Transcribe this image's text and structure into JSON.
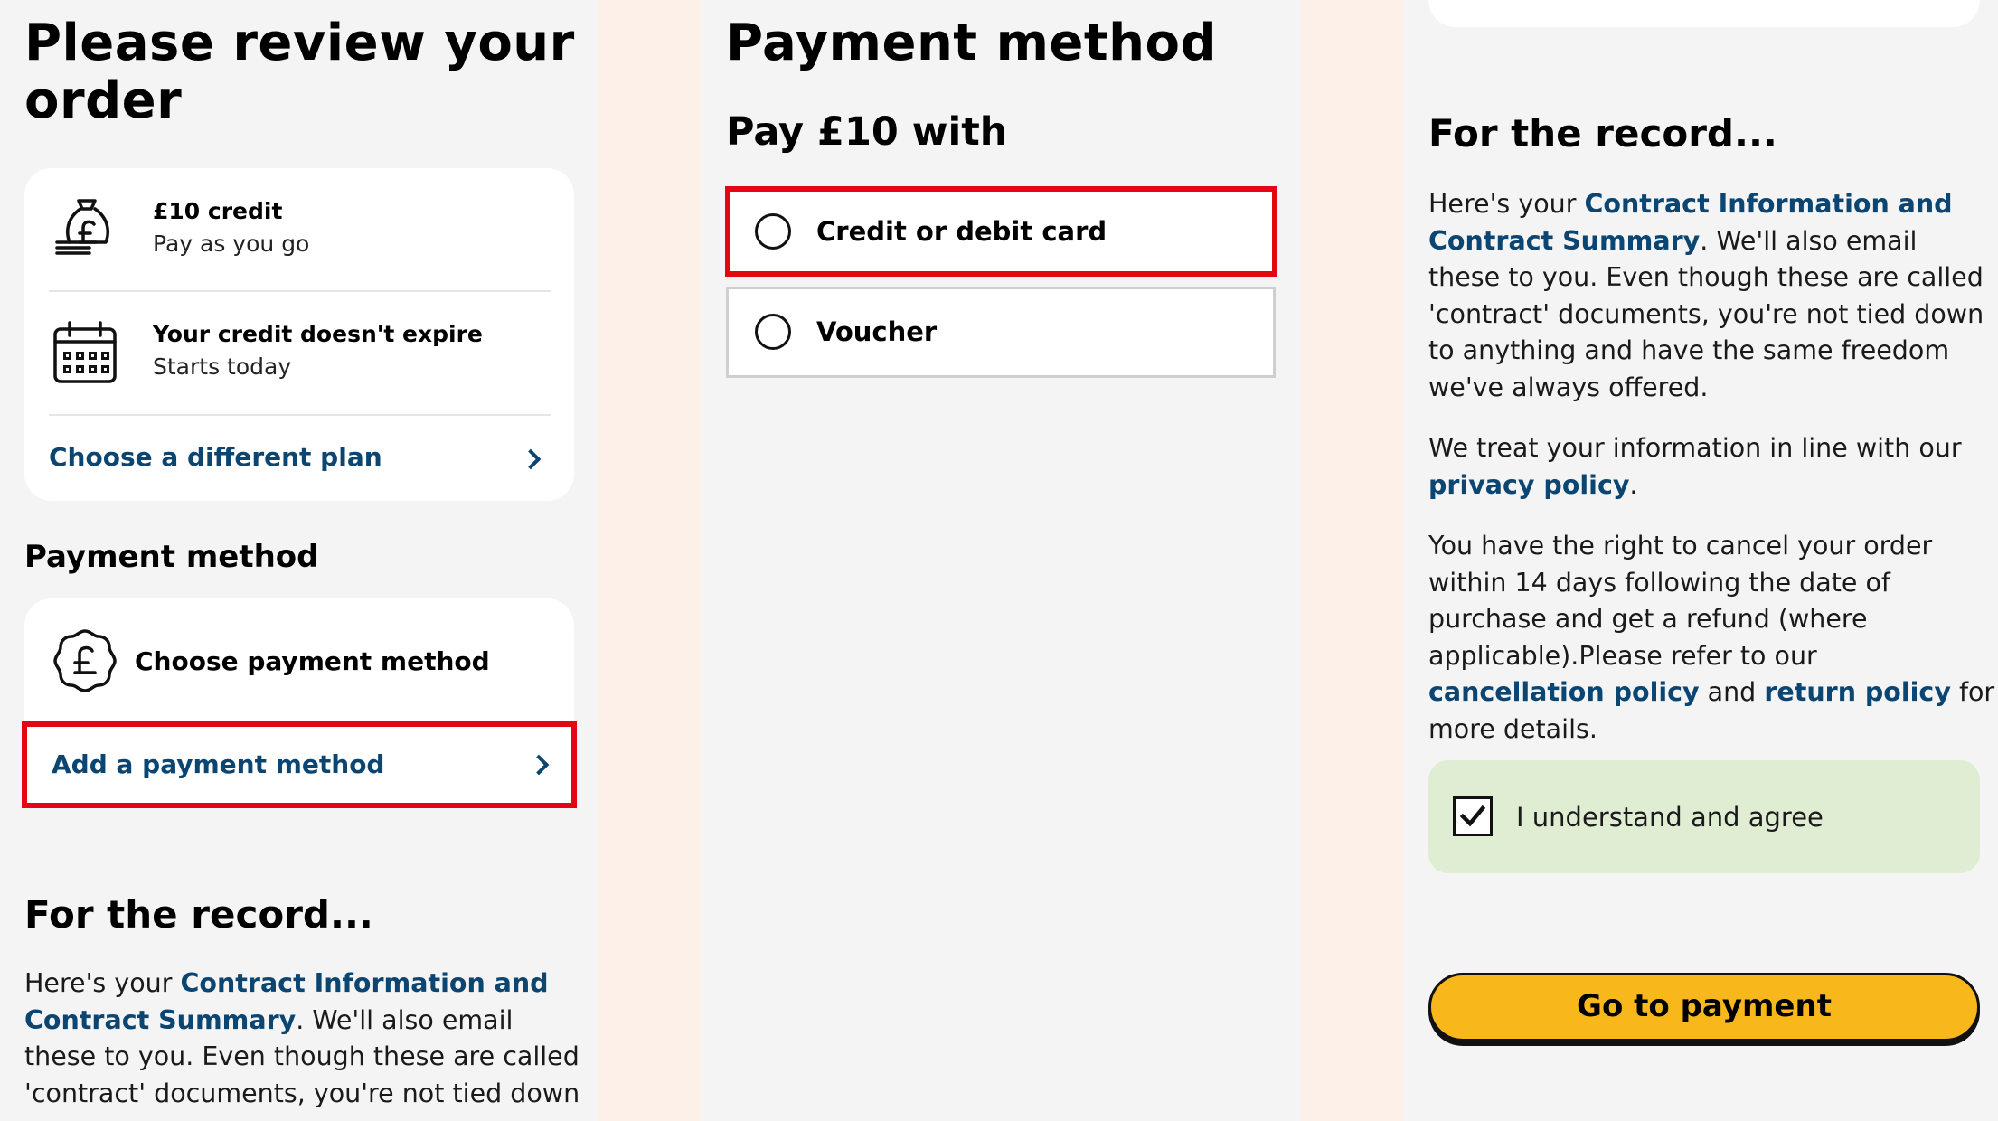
{
  "review": {
    "title_line1": "Please review your",
    "title_line2": "order",
    "plan": {
      "credit_title": "£10 credit",
      "credit_sub": "Pay as you go",
      "expiry_title": "Your credit doesn't expire",
      "expiry_sub": "Starts today",
      "change_link": "Choose a different plan"
    },
    "payment_heading": "Payment method",
    "payment_card": {
      "label": "Choose payment method",
      "add_link": "Add a payment method"
    },
    "record_heading": "For the record...",
    "record_text": {
      "pre": "Here's your ",
      "link": "Contract Information and Contract Summary",
      "post": ". We'll also email these to you. Even though these are called 'contract' documents, you're not tied down"
    }
  },
  "payment": {
    "title": "Payment method",
    "subtitle": "Pay £10 with",
    "options": [
      {
        "label": "Credit or debit card"
      },
      {
        "label": "Voucher"
      }
    ]
  },
  "record": {
    "heading": "For the record...",
    "p1_pre": "Here's your ",
    "p1_link": "Contract Information and Contract Summary",
    "p1_post": ". We'll also email these to you. Even though these are called 'contract' documents, you're not tied down to anything and have the same freedom we've always offered.",
    "p2_pre": "We treat your information in line with our ",
    "p2_link": "privacy policy",
    "p2_post": ".",
    "p3_pre": "You have the right to cancel your order within 14 days following the date of purchase and get a refund (where applicable).Please refer to our ",
    "p3_link1": "cancellation policy",
    "p3_mid": " and ",
    "p3_link2": "return policy",
    "p3_post": " for more details.",
    "agree_label": "I understand and agree",
    "cta": "Go to payment"
  },
  "colors": {
    "link": "#0b4572",
    "highlight_border": "#e30613",
    "cta_bg": "#f8b81c",
    "agree_bg": "#dfedd3",
    "gutter": "#fdf0e8",
    "panel": "#f4f4f4"
  },
  "icons": [
    "money-bag-icon",
    "calendar-icon",
    "pound-coin-icon",
    "chevron-right-icon",
    "checkbox-checked-icon",
    "radio-empty-icon"
  ]
}
